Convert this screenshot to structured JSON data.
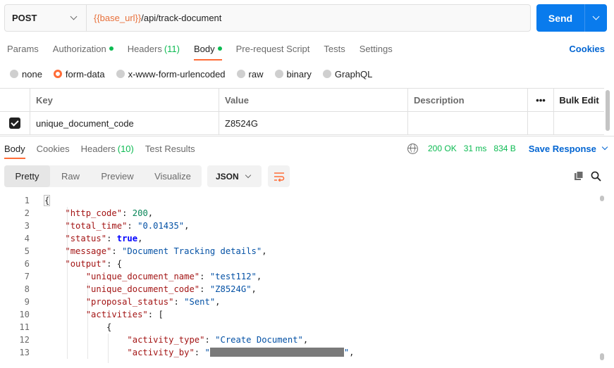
{
  "request": {
    "method": "POST",
    "url_var": "{{base_url}}",
    "url_path": "/api/track-document",
    "send_label": "Send"
  },
  "request_tabs": [
    {
      "label": "Params"
    },
    {
      "label": "Authorization",
      "dot": true
    },
    {
      "label": "Headers",
      "count": "(11)"
    },
    {
      "label": "Body",
      "dot": true,
      "active": true
    },
    {
      "label": "Pre-request Script"
    },
    {
      "label": "Tests"
    },
    {
      "label": "Settings"
    }
  ],
  "cookies_label": "Cookies",
  "body_types": [
    {
      "label": "none"
    },
    {
      "label": "form-data",
      "selected": true
    },
    {
      "label": "x-www-form-urlencoded"
    },
    {
      "label": "raw"
    },
    {
      "label": "binary"
    },
    {
      "label": "GraphQL"
    }
  ],
  "params_table": {
    "headers": [
      "Key",
      "Value",
      "Description",
      "Bulk Edit"
    ],
    "rows": [
      {
        "key": "unique_document_code",
        "value": "Z8524G",
        "description": "",
        "checked": true
      }
    ]
  },
  "response_tabs": [
    {
      "label": "Body",
      "active": true
    },
    {
      "label": "Cookies"
    },
    {
      "label": "Headers",
      "count": "(10)"
    },
    {
      "label": "Test Results"
    }
  ],
  "response_status": {
    "status": "200 OK",
    "time": "31 ms",
    "size": "834 B",
    "save_label": "Save Response"
  },
  "view_modes": [
    "Pretty",
    "Raw",
    "Preview",
    "Visualize"
  ],
  "active_view": "Pretty",
  "format": "JSON",
  "colors": {
    "accent": "#ff6c37",
    "send": "#097bed",
    "status_ok": "#0cbb52",
    "link": "#0265d2"
  },
  "icons": [
    "chevron-down-icon",
    "globe-icon",
    "wrap-lines-icon",
    "copy-icon",
    "search-icon",
    "checkbox-icon"
  ],
  "code_lines": [
    {
      "n": "1",
      "tokens": [
        [
          "p",
          "{"
        ]
      ]
    },
    {
      "n": "2",
      "tokens": [
        [
          "p",
          "    "
        ],
        [
          "k",
          "\"http_code\""
        ],
        [
          "p",
          ": "
        ],
        [
          "n",
          "200"
        ],
        [
          "p",
          ","
        ]
      ]
    },
    {
      "n": "3",
      "tokens": [
        [
          "p",
          "    "
        ],
        [
          "k",
          "\"total_time\""
        ],
        [
          "p",
          ": "
        ],
        [
          "s",
          "\"0.01435\""
        ],
        [
          "p",
          ","
        ]
      ]
    },
    {
      "n": "4",
      "tokens": [
        [
          "p",
          "    "
        ],
        [
          "k",
          "\"status\""
        ],
        [
          "p",
          ": "
        ],
        [
          "b",
          "true"
        ],
        [
          "p",
          ","
        ]
      ]
    },
    {
      "n": "5",
      "tokens": [
        [
          "p",
          "    "
        ],
        [
          "k",
          "\"message\""
        ],
        [
          "p",
          ": "
        ],
        [
          "s",
          "\"Document Tracking details\""
        ],
        [
          "p",
          ","
        ]
      ]
    },
    {
      "n": "6",
      "tokens": [
        [
          "p",
          "    "
        ],
        [
          "k",
          "\"output\""
        ],
        [
          "p",
          ": {"
        ]
      ]
    },
    {
      "n": "7",
      "tokens": [
        [
          "p",
          "        "
        ],
        [
          "k",
          "\"unique_document_name\""
        ],
        [
          "p",
          ": "
        ],
        [
          "s",
          "\"test112\""
        ],
        [
          "p",
          ","
        ]
      ]
    },
    {
      "n": "8",
      "tokens": [
        [
          "p",
          "        "
        ],
        [
          "k",
          "\"unique_document_code\""
        ],
        [
          "p",
          ": "
        ],
        [
          "s",
          "\"Z8524G\""
        ],
        [
          "p",
          ","
        ]
      ]
    },
    {
      "n": "9",
      "tokens": [
        [
          "p",
          "        "
        ],
        [
          "k",
          "\"proposal_status\""
        ],
        [
          "p",
          ": "
        ],
        [
          "s",
          "\"Sent\""
        ],
        [
          "p",
          ","
        ]
      ]
    },
    {
      "n": "10",
      "tokens": [
        [
          "p",
          "        "
        ],
        [
          "k",
          "\"activities\""
        ],
        [
          "p",
          ": ["
        ]
      ]
    },
    {
      "n": "11",
      "tokens": [
        [
          "p",
          "            {"
        ]
      ]
    },
    {
      "n": "12",
      "tokens": [
        [
          "p",
          "                "
        ],
        [
          "k",
          "\"activity_type\""
        ],
        [
          "p",
          ": "
        ],
        [
          "s",
          "\"Create Document\""
        ],
        [
          "p",
          ","
        ]
      ]
    },
    {
      "n": "13",
      "tokens": [
        [
          "p",
          "                "
        ],
        [
          "k",
          "\"activity_by\""
        ],
        [
          "p",
          ": "
        ],
        [
          "s",
          "\""
        ],
        [
          "r",
          ""
        ],
        [
          "s",
          "\""
        ],
        [
          "p",
          ","
        ]
      ]
    }
  ]
}
